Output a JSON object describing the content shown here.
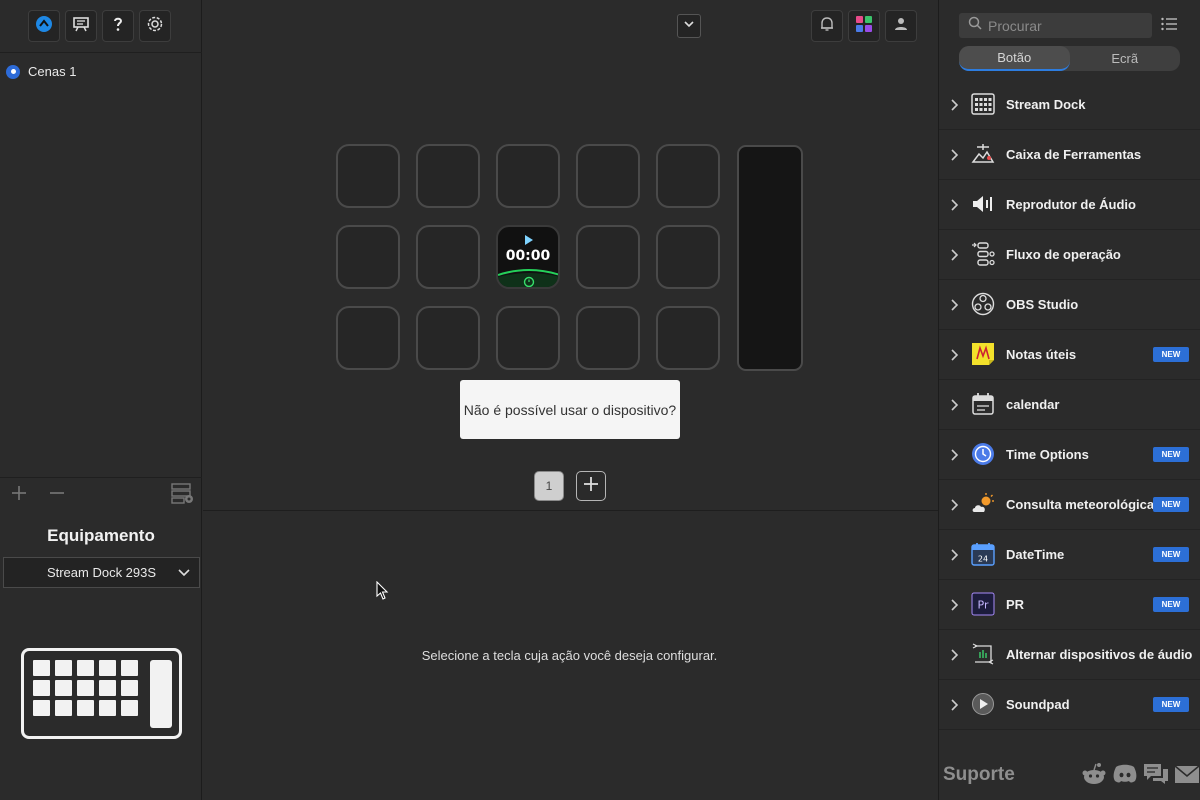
{
  "left": {
    "toolbar_icons": [
      "app-logo-icon",
      "presentation-icon",
      "help-icon",
      "settings-icon"
    ],
    "scenes": [
      {
        "label": "Cenas 1",
        "selected": true
      }
    ],
    "equipment_title": "Equipamento",
    "device_select": "Stream Dock 293S"
  },
  "center": {
    "timer_text": "00:00",
    "tooltip": "Não é possível usar o dispositivo?",
    "page_number": "1",
    "hint": "Selecione a tecla cuja ação você deseja configurar.",
    "icons": [
      "bell-icon",
      "color-grid-icon",
      "user-icon"
    ]
  },
  "right": {
    "search_placeholder": "Procurar",
    "tabs": [
      "Botão",
      "Ecrã"
    ],
    "active_tab": "Botão",
    "new_badge": "NEW",
    "plugins": [
      {
        "name": "Stream Dock",
        "icon": "keypad-icon",
        "new": false
      },
      {
        "name": "Caixa de Ferramentas",
        "icon": "toolbox-icon",
        "new": false
      },
      {
        "name": "Reprodutor de Áudio",
        "icon": "speaker-icon",
        "new": false
      },
      {
        "name": "Fluxo de operação",
        "icon": "workflow-icon",
        "new": false
      },
      {
        "name": "OBS Studio",
        "icon": "obs-icon",
        "new": false
      },
      {
        "name": "Notas úteis",
        "icon": "sticky-note-icon",
        "new": true
      },
      {
        "name": "calendar",
        "icon": "calendar-icon",
        "new": false
      },
      {
        "name": "Time Options",
        "icon": "clock-icon",
        "new": true
      },
      {
        "name": "Consulta meteorológica",
        "icon": "weather-icon",
        "new": true
      },
      {
        "name": "DateTime",
        "icon": "date-icon",
        "new": true
      },
      {
        "name": "PR",
        "icon": "premiere-icon",
        "new": true
      },
      {
        "name": "Alternar dispositivos de áudio",
        "icon": "audio-switch-icon",
        "new": false
      },
      {
        "name": "Soundpad",
        "icon": "soundpad-icon",
        "new": true
      }
    ],
    "support": "Suporte",
    "social": [
      "reddit-icon",
      "discord-icon",
      "chat-icon",
      "mail-icon"
    ]
  }
}
